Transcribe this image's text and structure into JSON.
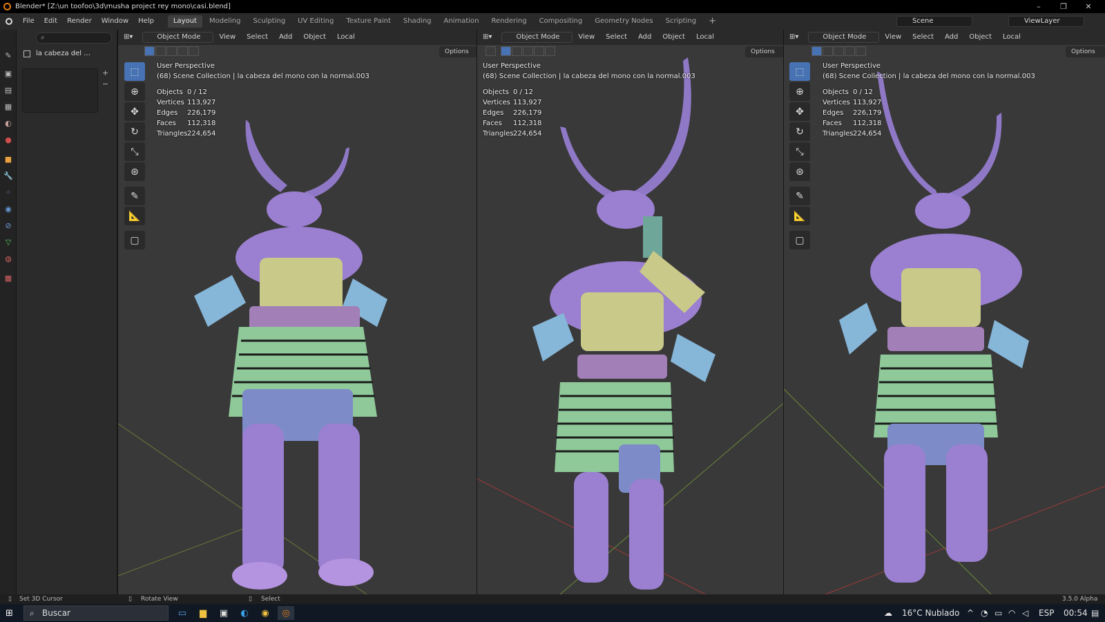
{
  "window": {
    "title": "Blender* [Z:\\un toofoo\\3d\\musha project rey mono\\casi.blend]",
    "controls": [
      "–",
      "❐",
      "✕"
    ]
  },
  "menu": [
    "File",
    "Edit",
    "Render",
    "Window",
    "Help"
  ],
  "workspaces": [
    "Layout",
    "Modeling",
    "Sculpting",
    "UV Editing",
    "Texture Paint",
    "Shading",
    "Animation",
    "Rendering",
    "Compositing",
    "Geometry Nodes",
    "Scripting"
  ],
  "active_workspace": "Layout",
  "scene_field": "Scene",
  "viewlayer_field": "ViewLayer",
  "side_panel": {
    "breadcrumb": "la cabeza del ...",
    "add_icon": "+",
    "remove_icon": "−"
  },
  "viewport_common": {
    "mode": "Object Mode",
    "menus": [
      "View",
      "Select",
      "Add",
      "Object"
    ],
    "orientation": "Local",
    "options_label": "Options",
    "perspective": "User Perspective",
    "collection": "(68) Scene Collection | la cabeza del mono con la normal.003",
    "stats": [
      {
        "label": "Objects",
        "value": "0 / 12"
      },
      {
        "label": "Vertices",
        "value": "113,927"
      },
      {
        "label": "Edges",
        "value": "226,179"
      },
      {
        "label": "Faces",
        "value": "112,318"
      },
      {
        "label": "Triangles",
        "value": "224,654"
      }
    ]
  },
  "status_bar": {
    "left": "Set 3D Cursor",
    "middle": "Rotate View",
    "right": "Select",
    "version": "3.5.0 Alpha"
  },
  "taskbar": {
    "search_placeholder": "Buscar",
    "weather": "16°C  Nublado",
    "language": "ESP",
    "time": "00:54"
  },
  "colors": {
    "viewport_bg": "#393939",
    "mesh_purple": "#9b7fd0",
    "mesh_blue": "#86b6d8",
    "mesh_yellow": "#c9c98a",
    "mesh_green": "#8fc99a",
    "accent": "#4772b3"
  }
}
